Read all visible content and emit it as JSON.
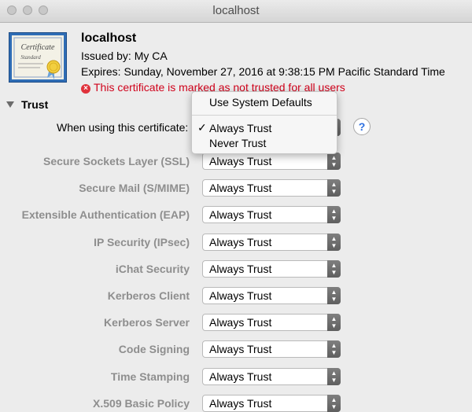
{
  "window": {
    "title": "localhost"
  },
  "certificate": {
    "name": "localhost",
    "issued_by": "Issued by: My CA",
    "expires": "Expires: Sunday, November 27, 2016 at 9:38:15 PM Pacific Standard Time",
    "warning": "This certificate is marked as not trusted for all users",
    "icon_text": [
      "Certificate",
      "Standard"
    ]
  },
  "trust": {
    "heading": "Trust",
    "when_label": "When using this certificate:",
    "help": "?",
    "menu": {
      "items": [
        {
          "label": "Use System Defaults",
          "checked": false
        },
        {
          "label": "Always Trust",
          "checked": true
        },
        {
          "label": "Never Trust",
          "checked": false
        }
      ],
      "checkmark": "✓"
    },
    "rows": [
      {
        "label": "Secure Sockets Layer (SSL)",
        "value": "Always Trust"
      },
      {
        "label": "Secure Mail (S/MIME)",
        "value": "Always Trust"
      },
      {
        "label": "Extensible Authentication (EAP)",
        "value": "Always Trust"
      },
      {
        "label": "IP Security (IPsec)",
        "value": "Always Trust"
      },
      {
        "label": "iChat Security",
        "value": "Always Trust"
      },
      {
        "label": "Kerberos Client",
        "value": "Always Trust"
      },
      {
        "label": "Kerberos Server",
        "value": "Always Trust"
      },
      {
        "label": "Code Signing",
        "value": "Always Trust"
      },
      {
        "label": "Time Stamping",
        "value": "Always Trust"
      },
      {
        "label": "X.509 Basic Policy",
        "value": "Always Trust"
      }
    ]
  },
  "colors": {
    "warning": "#d0021b",
    "disabled_label": "#8e8e8e",
    "help_accent": "#2c6fe0"
  }
}
